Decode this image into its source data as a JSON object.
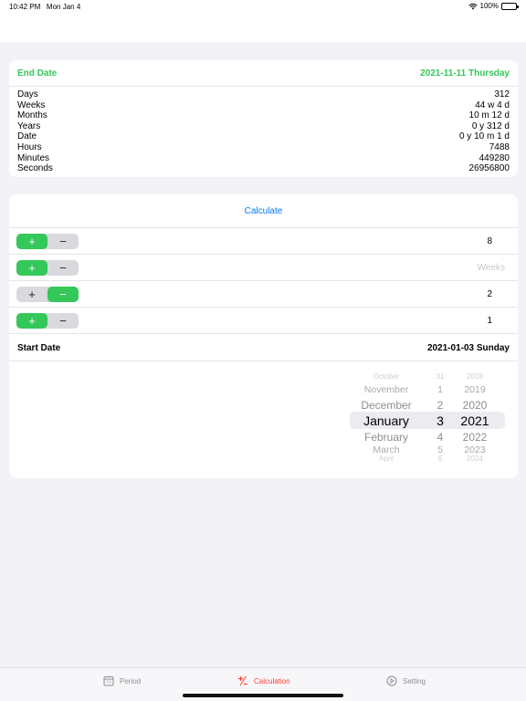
{
  "status": {
    "time": "10:42 PM",
    "date": "Mon Jan 4",
    "battery": "100%"
  },
  "end_date": {
    "label": "End Date",
    "value": "2021-11-11 Thursday"
  },
  "results": [
    {
      "label": "Days",
      "value": "312"
    },
    {
      "label": "Weeks",
      "value": "44 w 4 d"
    },
    {
      "label": "Months",
      "value": "10 m 12 d"
    },
    {
      "label": "Years",
      "value": "0 y 312 d"
    },
    {
      "label": "Date",
      "value": "0 y 10 m 1 d"
    },
    {
      "label": "Hours",
      "value": "7488"
    },
    {
      "label": "Minutes",
      "value": "449280"
    },
    {
      "label": "Seconds",
      "value": "26956800"
    }
  ],
  "calculate_label": "Calculate",
  "steppers": [
    {
      "value": "8",
      "placeholder": "",
      "active": "plus"
    },
    {
      "value": "",
      "placeholder": "Weeks",
      "active": "plus"
    },
    {
      "value": "2",
      "placeholder": "",
      "active": "minus"
    },
    {
      "value": "1",
      "placeholder": "",
      "active": "plus"
    }
  ],
  "stepper_symbols": {
    "plus": "+",
    "minus": "−"
  },
  "start_date": {
    "label": "Start Date",
    "value": "2021-01-03 Sunday"
  },
  "picker": {
    "rows": [
      {
        "month": "October",
        "day": "31",
        "year": "2018"
      },
      {
        "month": "November",
        "day": "1",
        "year": "2019"
      },
      {
        "month": "December",
        "day": "2",
        "year": "2020"
      },
      {
        "month": "January",
        "day": "3",
        "year": "2021"
      },
      {
        "month": "February",
        "day": "4",
        "year": "2022"
      },
      {
        "month": "March",
        "day": "5",
        "year": "2023"
      },
      {
        "month": "April",
        "day": "6",
        "year": "2024"
      }
    ],
    "selected_index": 3
  },
  "tabs": [
    {
      "label": "Period",
      "icon": "calendar-icon",
      "active": false
    },
    {
      "label": "Calculation",
      "icon": "plus-minus-icon",
      "active": true
    },
    {
      "label": "Setting",
      "icon": "gear-icon",
      "active": false
    }
  ],
  "colors": {
    "accent_green": "#34c759",
    "link_blue": "#007aff",
    "tab_active": "#ff3b30"
  }
}
